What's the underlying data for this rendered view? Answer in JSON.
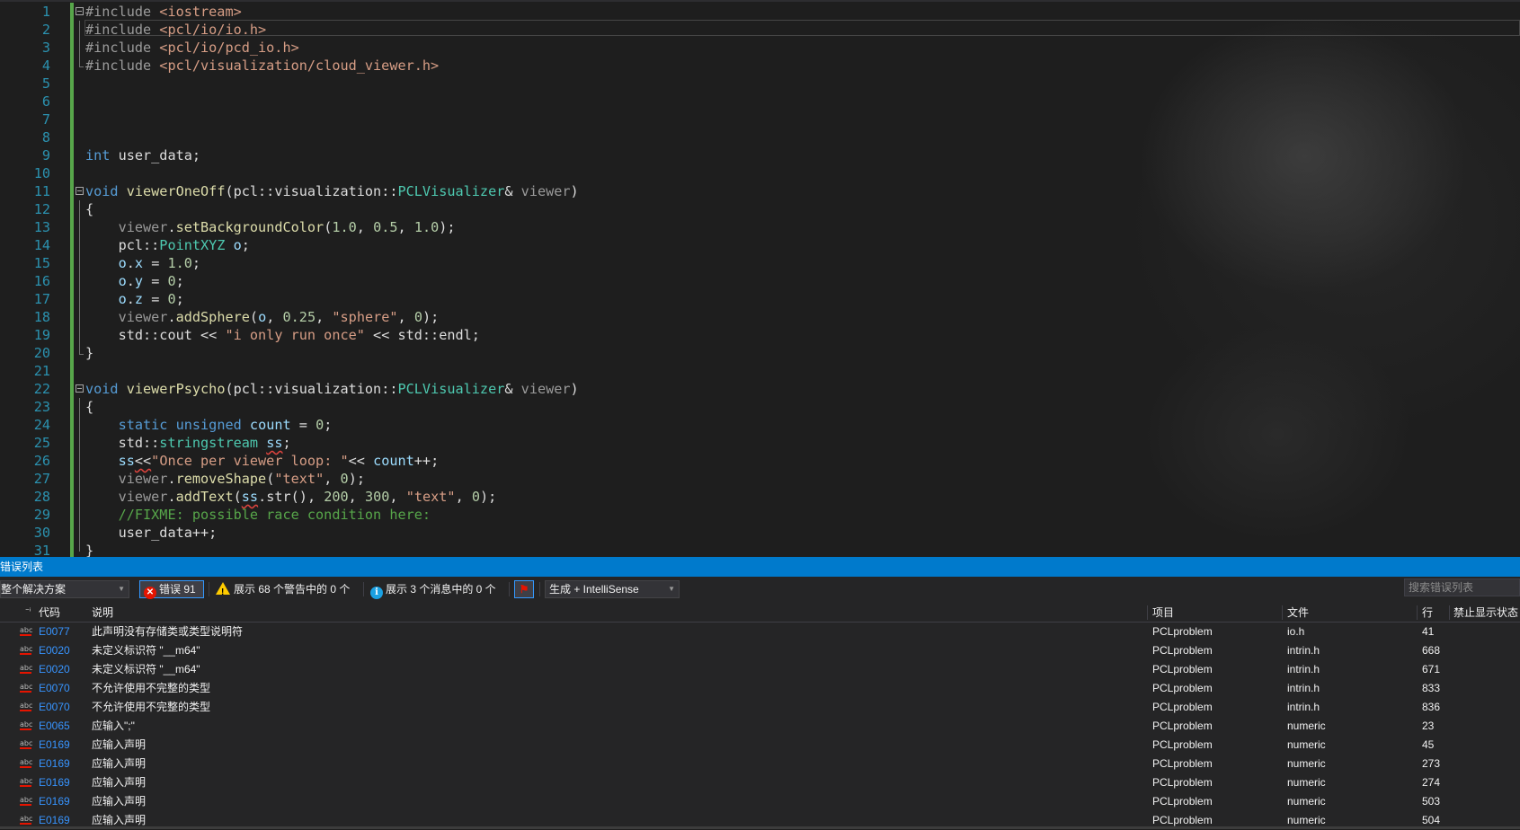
{
  "editor": {
    "lines": [
      {
        "n": "1",
        "tokens": [
          {
            "c": "t-pp",
            "t": "#include "
          },
          {
            "c": "t-inc",
            "t": "<iostream>"
          }
        ]
      },
      {
        "n": "2",
        "tokens": [
          {
            "c": "t-pp",
            "t": "#include "
          },
          {
            "c": "t-inc",
            "t": "<pcl/io/io.h>"
          }
        ]
      },
      {
        "n": "3",
        "tokens": [
          {
            "c": "t-pp",
            "t": "#include "
          },
          {
            "c": "t-inc",
            "t": "<pcl/io/pcd_io.h>"
          }
        ]
      },
      {
        "n": "4",
        "tokens": [
          {
            "c": "t-pp",
            "t": "#include "
          },
          {
            "c": "t-inc",
            "t": "<pcl/visualization/cloud_viewer.h>"
          }
        ]
      },
      {
        "n": "5",
        "tokens": []
      },
      {
        "n": "6",
        "tokens": []
      },
      {
        "n": "7",
        "tokens": []
      },
      {
        "n": "8",
        "tokens": []
      },
      {
        "n": "9",
        "tokens": [
          {
            "c": "t-kw",
            "t": "int"
          },
          {
            "c": "t-pl",
            "t": " "
          },
          {
            "c": "t-pl",
            "t": "user_data"
          },
          {
            "c": "t-pl",
            "t": ";"
          }
        ]
      },
      {
        "n": "10",
        "tokens": []
      },
      {
        "n": "11",
        "tokens": [
          {
            "c": "t-kw",
            "t": "void"
          },
          {
            "c": "t-pl",
            "t": " "
          },
          {
            "c": "t-fn",
            "t": "viewerOneOff"
          },
          {
            "c": "t-pl",
            "t": "(pcl::visualization::"
          },
          {
            "c": "t-cls",
            "t": "PCLVisualizer"
          },
          {
            "c": "t-pl",
            "t": "& "
          },
          {
            "c": "t-par",
            "t": "viewer"
          },
          {
            "c": "t-pl",
            "t": ")"
          }
        ]
      },
      {
        "n": "12",
        "tokens": [
          {
            "c": "t-pl",
            "t": "{"
          }
        ]
      },
      {
        "n": "13",
        "tokens": [
          {
            "c": "t-pl",
            "t": "    "
          },
          {
            "c": "t-par",
            "t": "viewer"
          },
          {
            "c": "t-pl",
            "t": "."
          },
          {
            "c": "t-fn",
            "t": "setBackgroundColor"
          },
          {
            "c": "t-pl",
            "t": "("
          },
          {
            "c": "t-num",
            "t": "1.0"
          },
          {
            "c": "t-pl",
            "t": ", "
          },
          {
            "c": "t-num",
            "t": "0.5"
          },
          {
            "c": "t-pl",
            "t": ", "
          },
          {
            "c": "t-num",
            "t": "1.0"
          },
          {
            "c": "t-pl",
            "t": ");"
          }
        ]
      },
      {
        "n": "14",
        "tokens": [
          {
            "c": "t-pl",
            "t": "    pcl::"
          },
          {
            "c": "t-cls",
            "t": "PointXYZ"
          },
          {
            "c": "t-pl",
            "t": " "
          },
          {
            "c": "t-var",
            "t": "o"
          },
          {
            "c": "t-pl",
            "t": ";"
          }
        ]
      },
      {
        "n": "15",
        "tokens": [
          {
            "c": "t-pl",
            "t": "    "
          },
          {
            "c": "t-var",
            "t": "o"
          },
          {
            "c": "t-pl",
            "t": "."
          },
          {
            "c": "t-var",
            "t": "x"
          },
          {
            "c": "t-pl",
            "t": " = "
          },
          {
            "c": "t-num",
            "t": "1.0"
          },
          {
            "c": "t-pl",
            "t": ";"
          }
        ]
      },
      {
        "n": "16",
        "tokens": [
          {
            "c": "t-pl",
            "t": "    "
          },
          {
            "c": "t-var",
            "t": "o"
          },
          {
            "c": "t-pl",
            "t": "."
          },
          {
            "c": "t-var",
            "t": "y"
          },
          {
            "c": "t-pl",
            "t": " = "
          },
          {
            "c": "t-num",
            "t": "0"
          },
          {
            "c": "t-pl",
            "t": ";"
          }
        ]
      },
      {
        "n": "17",
        "tokens": [
          {
            "c": "t-pl",
            "t": "    "
          },
          {
            "c": "t-var",
            "t": "o"
          },
          {
            "c": "t-pl",
            "t": "."
          },
          {
            "c": "t-var",
            "t": "z"
          },
          {
            "c": "t-pl",
            "t": " = "
          },
          {
            "c": "t-num",
            "t": "0"
          },
          {
            "c": "t-pl",
            "t": ";"
          }
        ]
      },
      {
        "n": "18",
        "tokens": [
          {
            "c": "t-pl",
            "t": "    "
          },
          {
            "c": "t-par",
            "t": "viewer"
          },
          {
            "c": "t-pl",
            "t": "."
          },
          {
            "c": "t-fn",
            "t": "addSphere"
          },
          {
            "c": "t-pl",
            "t": "("
          },
          {
            "c": "t-var",
            "t": "o"
          },
          {
            "c": "t-pl",
            "t": ", "
          },
          {
            "c": "t-num",
            "t": "0.25"
          },
          {
            "c": "t-pl",
            "t": ", "
          },
          {
            "c": "t-str",
            "t": "\"sphere\""
          },
          {
            "c": "t-pl",
            "t": ", "
          },
          {
            "c": "t-num",
            "t": "0"
          },
          {
            "c": "t-pl",
            "t": ");"
          }
        ]
      },
      {
        "n": "19",
        "tokens": [
          {
            "c": "t-pl",
            "t": "    std::"
          },
          {
            "c": "t-pl",
            "t": "cout"
          },
          {
            "c": "t-pl",
            "t": " << "
          },
          {
            "c": "t-str",
            "t": "\"i only run once\""
          },
          {
            "c": "t-pl",
            "t": " << std::"
          },
          {
            "c": "t-pl",
            "t": "endl"
          },
          {
            "c": "t-pl",
            "t": ";"
          }
        ]
      },
      {
        "n": "20",
        "tokens": [
          {
            "c": "t-pl",
            "t": "}"
          }
        ]
      },
      {
        "n": "21",
        "tokens": []
      },
      {
        "n": "22",
        "tokens": [
          {
            "c": "t-kw",
            "t": "void"
          },
          {
            "c": "t-pl",
            "t": " "
          },
          {
            "c": "t-fn",
            "t": "viewerPsycho"
          },
          {
            "c": "t-pl",
            "t": "(pcl::visualization::"
          },
          {
            "c": "t-cls",
            "t": "PCLVisualizer"
          },
          {
            "c": "t-pl",
            "t": "& "
          },
          {
            "c": "t-par",
            "t": "viewer"
          },
          {
            "c": "t-pl",
            "t": ")"
          }
        ]
      },
      {
        "n": "23",
        "tokens": [
          {
            "c": "t-pl",
            "t": "{"
          }
        ]
      },
      {
        "n": "24",
        "tokens": [
          {
            "c": "t-pl",
            "t": "    "
          },
          {
            "c": "t-kw",
            "t": "static"
          },
          {
            "c": "t-pl",
            "t": " "
          },
          {
            "c": "t-kw",
            "t": "unsigned"
          },
          {
            "c": "t-pl",
            "t": " "
          },
          {
            "c": "t-var",
            "t": "count"
          },
          {
            "c": "t-pl",
            "t": " = "
          },
          {
            "c": "t-num",
            "t": "0"
          },
          {
            "c": "t-pl",
            "t": ";"
          }
        ]
      },
      {
        "n": "25",
        "tokens": [
          {
            "c": "t-pl",
            "t": "    std::"
          },
          {
            "c": "t-cls",
            "t": "stringstream"
          },
          {
            "c": "t-pl",
            "t": " "
          },
          {
            "c": "t-var t-sq",
            "t": "ss"
          },
          {
            "c": "t-pl",
            "t": ";"
          }
        ]
      },
      {
        "n": "26",
        "tokens": [
          {
            "c": "t-pl",
            "t": "    "
          },
          {
            "c": "t-var",
            "t": "ss"
          },
          {
            "c": "t-pl t-sq",
            "t": "<<"
          },
          {
            "c": "t-str",
            "t": "\"Once per viewer loop: \""
          },
          {
            "c": "t-pl",
            "t": "<< "
          },
          {
            "c": "t-var",
            "t": "count"
          },
          {
            "c": "t-pl",
            "t": "++;"
          }
        ]
      },
      {
        "n": "27",
        "tokens": [
          {
            "c": "t-pl",
            "t": "    "
          },
          {
            "c": "t-par",
            "t": "viewer"
          },
          {
            "c": "t-pl",
            "t": "."
          },
          {
            "c": "t-fn",
            "t": "removeShape"
          },
          {
            "c": "t-pl",
            "t": "("
          },
          {
            "c": "t-str",
            "t": "\"text\""
          },
          {
            "c": "t-pl",
            "t": ", "
          },
          {
            "c": "t-num",
            "t": "0"
          },
          {
            "c": "t-pl",
            "t": ");"
          }
        ]
      },
      {
        "n": "28",
        "tokens": [
          {
            "c": "t-pl",
            "t": "    "
          },
          {
            "c": "t-par",
            "t": "viewer"
          },
          {
            "c": "t-pl",
            "t": "."
          },
          {
            "c": "t-fn",
            "t": "addText"
          },
          {
            "c": "t-pl",
            "t": "("
          },
          {
            "c": "t-var t-sq",
            "t": "ss"
          },
          {
            "c": "t-pl",
            "t": ".str(), "
          },
          {
            "c": "t-num",
            "t": "200"
          },
          {
            "c": "t-pl",
            "t": ", "
          },
          {
            "c": "t-num",
            "t": "300"
          },
          {
            "c": "t-pl",
            "t": ", "
          },
          {
            "c": "t-str",
            "t": "\"text\""
          },
          {
            "c": "t-pl",
            "t": ", "
          },
          {
            "c": "t-num",
            "t": "0"
          },
          {
            "c": "t-pl",
            "t": ");"
          }
        ]
      },
      {
        "n": "29",
        "tokens": [
          {
            "c": "t-pl",
            "t": "    "
          },
          {
            "c": "t-cmt",
            "t": "//FIXME: possible race condition here:"
          }
        ]
      },
      {
        "n": "30",
        "tokens": [
          {
            "c": "t-pl",
            "t": "    "
          },
          {
            "c": "t-pl",
            "t": "user_data"
          },
          {
            "c": "t-pl",
            "t": "++;"
          }
        ]
      },
      {
        "n": "31",
        "tokens": [
          {
            "c": "t-pl",
            "t": "}"
          }
        ]
      }
    ]
  },
  "error_panel": {
    "title": "错误列表",
    "scope": "整个解决方案",
    "errors_label": "错误 91",
    "warnings_label": "展示 68 个警告中的 0 个",
    "messages_label": "展示 3 个消息中的 0 个",
    "build_filter": "生成 + IntelliSense",
    "search_placeholder": "搜索错误列表",
    "columns": {
      "code": "代码",
      "description": "说明",
      "project": "项目",
      "file": "文件",
      "line": "行",
      "suppress": "禁止显示状态"
    },
    "rows": [
      {
        "code": "E0077",
        "description": "此声明没有存储类或类型说明符",
        "project": "PCLproblem",
        "file": "io.h",
        "line": "41"
      },
      {
        "code": "E0020",
        "description": "未定义标识符 \"__m64\"",
        "project": "PCLproblem",
        "file": "intrin.h",
        "line": "668"
      },
      {
        "code": "E0020",
        "description": "未定义标识符 \"__m64\"",
        "project": "PCLproblem",
        "file": "intrin.h",
        "line": "671"
      },
      {
        "code": "E0070",
        "description": "不允许使用不完整的类型",
        "project": "PCLproblem",
        "file": "intrin.h",
        "line": "833"
      },
      {
        "code": "E0070",
        "description": "不允许使用不完整的类型",
        "project": "PCLproblem",
        "file": "intrin.h",
        "line": "836"
      },
      {
        "code": "E0065",
        "description": "应输入\";\"",
        "project": "PCLproblem",
        "file": "numeric",
        "line": "23"
      },
      {
        "code": "E0169",
        "description": "应输入声明",
        "project": "PCLproblem",
        "file": "numeric",
        "line": "45"
      },
      {
        "code": "E0169",
        "description": "应输入声明",
        "project": "PCLproblem",
        "file": "numeric",
        "line": "273"
      },
      {
        "code": "E0169",
        "description": "应输入声明",
        "project": "PCLproblem",
        "file": "numeric",
        "line": "274"
      },
      {
        "code": "E0169",
        "description": "应输入声明",
        "project": "PCLproblem",
        "file": "numeric",
        "line": "503"
      },
      {
        "code": "E0169",
        "description": "应输入声明",
        "project": "PCLproblem",
        "file": "numeric",
        "line": "504"
      }
    ]
  }
}
